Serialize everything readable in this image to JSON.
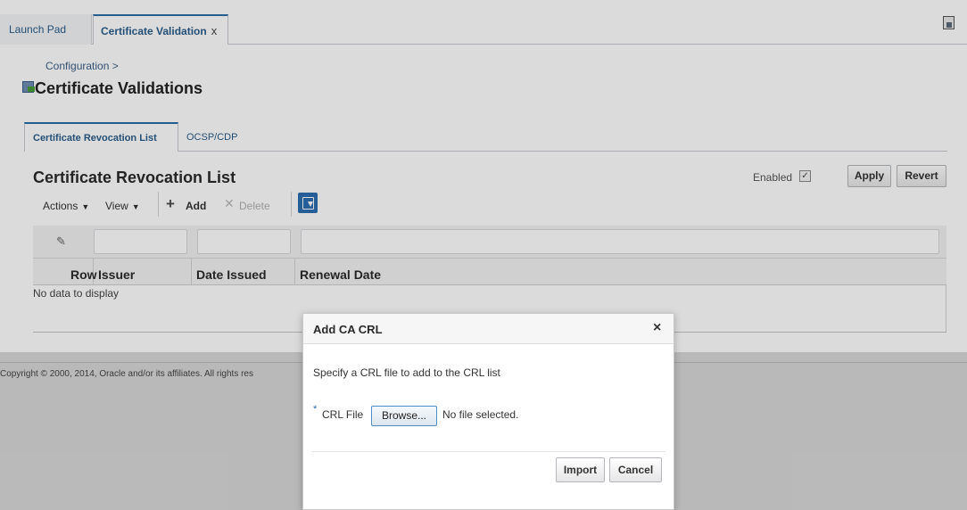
{
  "tabs": {
    "launch_pad": "Launch Pad",
    "certificate_validation": "Certificate Validation",
    "close_glyph": "x"
  },
  "page": {
    "breadcrumb": "Configuration >",
    "title": "Certificate Validations"
  },
  "subtabs": {
    "crl": "Certificate Revocation List",
    "ocsp": "OCSP/CDP"
  },
  "crl_section": {
    "heading": "Certificate Revocation List",
    "enabled_label": "Enabled",
    "enabled_checked": true,
    "apply": "Apply",
    "revert": "Revert"
  },
  "toolbar": {
    "actions": "Actions",
    "view": "View",
    "add": "Add",
    "delete": "Delete",
    "icons": [
      "pencil-icon",
      "plus-icon",
      "delete-x-icon",
      "query-by-example-icon"
    ]
  },
  "table": {
    "columns": [
      "Row",
      "Issuer",
      "Date Issued",
      "Renewal Date"
    ],
    "rows": [],
    "empty_text": "No data to display"
  },
  "footer": {
    "copyright": "Copyright © 2000, 2014, Oracle and/or its affiliates. All rights res"
  },
  "dialog": {
    "title": "Add CA CRL",
    "close_glyph": "×",
    "instructions": "Specify a CRL file to add to the CRL list",
    "required_mark": "*",
    "file_label": "CRL File",
    "browse": "Browse...",
    "no_file": "No file selected.",
    "import": "Import",
    "cancel": "Cancel"
  },
  "colors": {
    "accent": "#2b6ea8",
    "link": "#2b5d8a"
  }
}
